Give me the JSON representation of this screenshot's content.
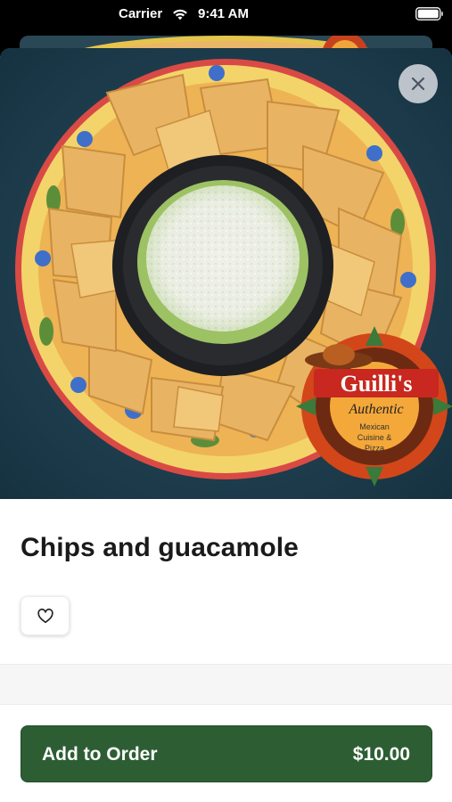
{
  "status_bar": {
    "carrier": "Carrier",
    "time": "9:41 AM"
  },
  "item": {
    "title": "Chips and guacamole",
    "image_logo_text": "Guilli's Authentic Mexican Cuisine & Pizza"
  },
  "actions": {
    "add_to_order_label": "Add to Order",
    "price": "$10.00"
  },
  "colors": {
    "primary_button": "#2d5e33",
    "title_text": "#1a1a1a"
  },
  "icons": {
    "close": "close-icon",
    "favorite": "heart-icon",
    "wifi": "wifi-icon",
    "battery": "battery-icon"
  }
}
